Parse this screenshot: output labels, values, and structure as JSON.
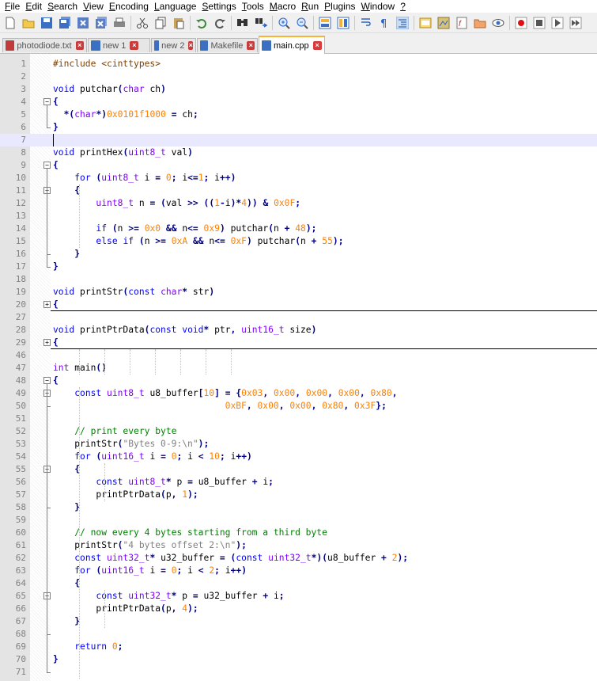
{
  "menu": [
    "File",
    "Edit",
    "Search",
    "View",
    "Encoding",
    "Language",
    "Settings",
    "Tools",
    "Macro",
    "Run",
    "Plugins",
    "Window",
    "?"
  ],
  "toolbar": [
    "new-icon",
    "open-icon",
    "save-icon",
    "save-all-icon",
    "close-icon",
    "close-all-icon",
    "print-icon",
    "cut-icon",
    "copy-icon",
    "paste-icon",
    "undo-icon",
    "redo-icon",
    "find-icon",
    "replace-icon",
    "zoom-in-icon",
    "zoom-out-icon",
    "sync-vertical-icon",
    "sync-horizontal-icon",
    "word-wrap-icon",
    "show-all-chars-icon",
    "indent-guide-icon",
    "udl-icon",
    "doc-map-icon",
    "function-list-icon",
    "folder-workspace-icon",
    "monitor-icon",
    "record-macro-icon",
    "stop-record-icon",
    "play-macro-icon",
    "run-macro-multiple-icon"
  ],
  "tabs": [
    {
      "label": "photodiode.txt",
      "active": false,
      "color": "#c23b3b"
    },
    {
      "label": "new 1",
      "active": false,
      "color": "#3a6fc2"
    },
    {
      "label": "new 2",
      "active": false,
      "color": "#3a6fc2"
    },
    {
      "label": "Makefile",
      "active": false,
      "color": "#3a6fc2"
    },
    {
      "label": "main.cpp",
      "active": true,
      "color": "#3a6fc2"
    }
  ],
  "colors": {
    "keyword": "#0000ff",
    "type": "#8000ff",
    "number": "#ff8000",
    "string": "#808080",
    "comment": "#008000",
    "preprocessor": "#804000"
  },
  "lines": [
    {
      "n": "1",
      "text": "#include <cinttypes>"
    },
    {
      "n": "2",
      "text": ""
    },
    {
      "n": "3",
      "text": "void putchar(char ch)"
    },
    {
      "n": "4",
      "text": "{"
    },
    {
      "n": "5",
      "text": "  *(char*)0x0101f1000 = ch;"
    },
    {
      "n": "6",
      "text": "}"
    },
    {
      "n": "7",
      "text": ""
    },
    {
      "n": "8",
      "text": "void printHex(uint8_t val)"
    },
    {
      "n": "9",
      "text": "{"
    },
    {
      "n": "10",
      "text": "    for (uint8_t i = 0; i<=1; i++)"
    },
    {
      "n": "11",
      "text": "    {"
    },
    {
      "n": "12",
      "text": "        uint8_t n = (val >> ((1-i)*4)) & 0x0F;"
    },
    {
      "n": "13",
      "text": ""
    },
    {
      "n": "14",
      "text": "        if (n >= 0x0 && n<= 0x9) putchar(n + 48);"
    },
    {
      "n": "15",
      "text": "        else if (n >= 0xA && n<= 0xF) putchar(n + 55);"
    },
    {
      "n": "16",
      "text": "    }"
    },
    {
      "n": "17",
      "text": "}"
    },
    {
      "n": "18",
      "text": ""
    },
    {
      "n": "19",
      "text": "void printStr(const char* str)"
    },
    {
      "n": "20",
      "text": "{"
    },
    {
      "n": "27",
      "text": ""
    },
    {
      "n": "28",
      "text": "void printPtrData(const void* ptr, uint16_t size)"
    },
    {
      "n": "29",
      "text": "{"
    },
    {
      "n": "46",
      "text": ""
    },
    {
      "n": "47",
      "text": "int main()"
    },
    {
      "n": "48",
      "text": "{"
    },
    {
      "n": "49",
      "text": "    const uint8_t u8_buffer[10] = {0x03, 0x00, 0x00, 0x00, 0x80,"
    },
    {
      "n": "50",
      "text": "                                0xBF, 0x00, 0x00, 0x80, 0x3F};"
    },
    {
      "n": "51",
      "text": ""
    },
    {
      "n": "52",
      "text": "    // print every byte"
    },
    {
      "n": "53",
      "text": "    printStr(\"Bytes 0-9:\\n\");"
    },
    {
      "n": "54",
      "text": "    for (uint16_t i = 0; i < 10; i++)"
    },
    {
      "n": "55",
      "text": "    {"
    },
    {
      "n": "56",
      "text": "        const uint8_t* p = u8_buffer + i;"
    },
    {
      "n": "57",
      "text": "        printPtrData(p, 1);"
    },
    {
      "n": "58",
      "text": "    }"
    },
    {
      "n": "59",
      "text": ""
    },
    {
      "n": "60",
      "text": "    // now every 4 bytes starting from a third byte"
    },
    {
      "n": "61",
      "text": "    printStr(\"4 bytes offset 2:\\n\");"
    },
    {
      "n": "62",
      "text": "    const uint32_t* u32_buffer = (const uint32_t*)(u8_buffer + 2);"
    },
    {
      "n": "63",
      "text": "    for (uint16_t i = 0; i < 2; i++)"
    },
    {
      "n": "64",
      "text": "    {"
    },
    {
      "n": "65",
      "text": "        const uint32_t* p = u32_buffer + i;"
    },
    {
      "n": "66",
      "text": "        printPtrData(p, 4);"
    },
    {
      "n": "67",
      "text": "    }"
    },
    {
      "n": "68",
      "text": ""
    },
    {
      "n": "69",
      "text": "    return 0;"
    },
    {
      "n": "70",
      "text": "}"
    },
    {
      "n": "71",
      "text": ""
    }
  ]
}
